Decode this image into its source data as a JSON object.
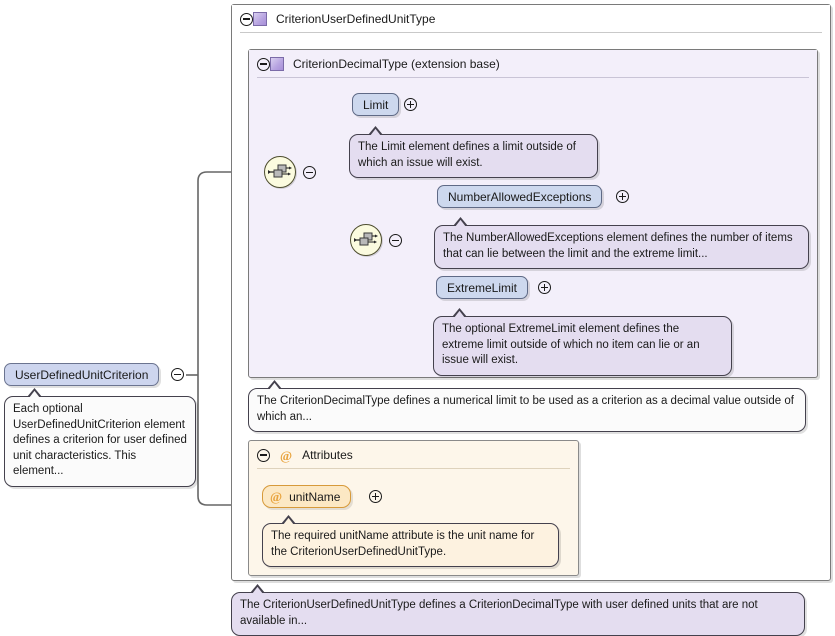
{
  "diagram": {
    "kind": "xsd-schema-diagram",
    "title": "CriterionUserDefinedUnitType"
  },
  "root_element": {
    "name": "UserDefinedUnitCriterion",
    "toggle": "minus-icon",
    "documentation": "Each optional UserDefinedUnitCriterion element defines a criterion for user defined unit characteristics. This element..."
  },
  "outer_type": {
    "name": "CriterionUserDefinedUnitType",
    "toggle": "minus-icon",
    "icon": "complex-type-swatch",
    "documentation": "The CriterionUserDefinedUnitType defines a CriterionDecimalType with user defined units that are not available in..."
  },
  "inner_type": {
    "name": "CriterionDecimalType (extension base)",
    "toggle": "minus-icon",
    "icon": "complex-type-swatch",
    "documentation": "The CriterionDecimalType defines a numerical limit to be used as a criterion as a decimal value outside of which an..."
  },
  "compositors": [
    {
      "id": "seq-outer",
      "kind": "sequence-icon",
      "toggle": "minus-icon"
    },
    {
      "id": "seq-inner",
      "kind": "sequence-icon",
      "toggle": "minus-icon"
    }
  ],
  "elements": [
    {
      "name": "Limit",
      "toggle": "plus-icon",
      "documentation": "The Limit element defines a limit outside of which an issue will exist."
    },
    {
      "name": "NumberAllowedExceptions",
      "toggle": "plus-icon",
      "documentation": "The NumberAllowedExceptions element defines the number of items that can lie between the limit and the extreme limit..."
    },
    {
      "name": "ExtremeLimit",
      "toggle": "plus-icon",
      "documentation": "The optional ExtremeLimit element defines the extreme limit outside of which no item can lie or an issue will exist."
    }
  ],
  "attributes_section": {
    "label": "Attributes",
    "toggle": "minus-icon",
    "icon": "at-icon",
    "attributes": [
      {
        "name": "unitName",
        "icon": "at-icon",
        "toggle": "plus-icon",
        "documentation": "The required unitName attribute is the unit name for the CriterionUserDefinedUnitType."
      }
    ]
  },
  "colors": {
    "element_fill": "#cdd8ee",
    "element_stroke": "#5f6a86",
    "attribute_fill": "#fce8c4",
    "attribute_stroke": "#d79a3a",
    "inner_type_fill": "#f3effa",
    "doc_fill": "#e4ddf0",
    "doc_white_fill": "#fbfbfb",
    "doc_cream_fill": "#fdf2e0",
    "attributes_frame_fill": "#fdf6ea",
    "sequence_fill": "#fbfbdf",
    "connector_stroke": "#666666"
  }
}
